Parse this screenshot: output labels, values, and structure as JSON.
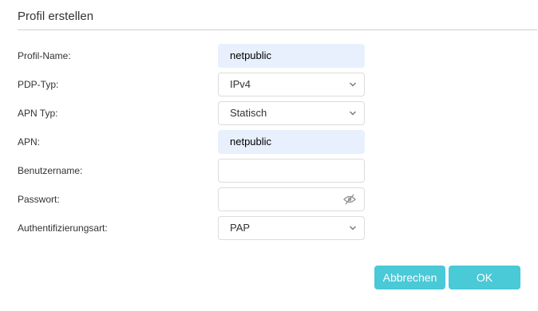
{
  "title": "Profil erstellen",
  "fields": {
    "profile_name": {
      "label": "Profil-Name:",
      "value": "netpublic"
    },
    "pdp_type": {
      "label": "PDP-Typ:",
      "value": "IPv4"
    },
    "apn_type": {
      "label": "APN Typ:",
      "value": "Statisch"
    },
    "apn": {
      "label": "APN:",
      "value": "netpublic"
    },
    "username": {
      "label": "Benutzername:",
      "value": ""
    },
    "password": {
      "label": "Passwort:",
      "value": ""
    },
    "auth_type": {
      "label": "Authentifizierungsart:",
      "value": "PAP"
    }
  },
  "buttons": {
    "cancel": "Abbrechen",
    "ok": "OK"
  },
  "colors": {
    "accent": "#4ac9d6",
    "autofill": "#e8f0fe"
  },
  "icons": [
    "chevron-down-icon",
    "eye-off-icon"
  ]
}
